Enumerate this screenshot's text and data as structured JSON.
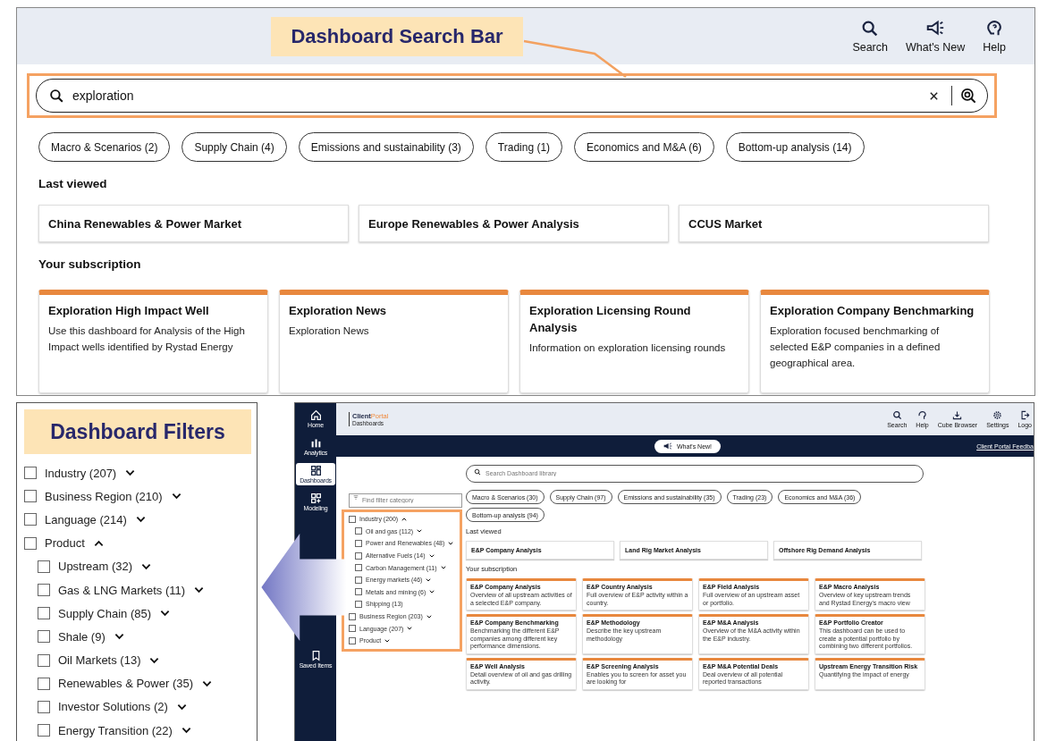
{
  "search_view": {
    "callout": "Dashboard Search Bar",
    "header_actions": [
      {
        "kind": "search",
        "label": "Search"
      },
      {
        "kind": "megaphone",
        "label": "What's New"
      },
      {
        "kind": "help",
        "label": "Help"
      }
    ],
    "search_field": {
      "value": "exploration"
    },
    "categories": [
      "Macro & Scenarios (2)",
      "Supply Chain (4)",
      "Emissions and sustainability (3)",
      "Trading (1)",
      "Economics and M&A (6)",
      "Bottom-up analysis (14)"
    ],
    "last_viewed_heading": "Last viewed",
    "last_viewed": [
      "China Renewables & Power Market",
      "Europe Renewables & Power Analysis",
      "CCUS Market"
    ],
    "subscription_heading": "Your subscription",
    "subscription": [
      {
        "title": "Exploration High Impact Well",
        "description": "Use this dashboard for Analysis of the High Impact wells identified by Rystad Energy"
      },
      {
        "title": "Exploration News",
        "description": "Exploration News"
      },
      {
        "title": "Exploration Licensing Round Analysis",
        "description": "Information on exploration licensing rounds"
      },
      {
        "title": "Exploration Company Benchmarking",
        "description": "Exploration focused benchmarking of selected E&P companies in a defined geographical area."
      }
    ]
  },
  "filters_view": {
    "callout": "Dashboard Filters",
    "filters": [
      {
        "label": "Industry (207)",
        "checked": false,
        "expanded": false
      },
      {
        "label": "Business Region (210)",
        "checked": false,
        "expanded": false
      },
      {
        "label": "Language (214)",
        "checked": false,
        "expanded": false
      },
      {
        "label": "Product",
        "checked": false,
        "expanded": true,
        "children": [
          {
            "label": "Upstream (32)",
            "checked": false,
            "expanded": false
          },
          {
            "label": "Gas & LNG Markets (11)",
            "checked": false,
            "expanded": false
          },
          {
            "label": "Supply Chain (85)",
            "checked": false,
            "expanded": false
          },
          {
            "label": "Shale (9)",
            "checked": false,
            "expanded": false
          },
          {
            "label": "Oil Markets (13)",
            "checked": false,
            "expanded": false
          },
          {
            "label": "Renewables & Power (35)",
            "checked": false,
            "expanded": false
          },
          {
            "label": "Investor Solutions (2)",
            "checked": false,
            "expanded": false
          },
          {
            "label": "Energy Transition (22)",
            "checked": false,
            "expanded": false
          }
        ]
      }
    ]
  },
  "portal": {
    "brand_first": "Client",
    "brand_second": "Portal",
    "section": "Dashboards",
    "nav": [
      {
        "kind": "home",
        "label": "Home",
        "selected": false
      },
      {
        "kind": "analytics",
        "label": "Analytics",
        "selected": false
      },
      {
        "kind": "dashboards",
        "label": "Dashboards",
        "selected": true
      },
      {
        "kind": "modeling",
        "label": "Modeling",
        "selected": false
      },
      {
        "kind": "saved",
        "label": "Saved Items",
        "selected": false
      }
    ],
    "actions": [
      {
        "kind": "search",
        "label": "Search"
      },
      {
        "kind": "help",
        "label": "Help"
      },
      {
        "kind": "download",
        "label": "Cube Browser"
      },
      {
        "kind": "gear",
        "label": "Settings"
      },
      {
        "kind": "logout",
        "label": "Logo"
      }
    ],
    "whats_new": "What's New!",
    "feedback_link": "Client Portal Feedba",
    "search_placeholder": "Search Dashboard library",
    "filter_placeholder": "Find filter category",
    "filters": [
      {
        "label": "Industry (200)",
        "checked": false,
        "expanded": true,
        "children": [
          {
            "label": "Oil and gas (112)",
            "checked": false,
            "expanded": false
          },
          {
            "label": "Power and Renewables (48)",
            "checked": false,
            "expanded": false
          },
          {
            "label": "Alternative Fuels (14)",
            "checked": false,
            "expanded": false
          },
          {
            "label": "Carbon Management (11)",
            "checked": false,
            "expanded": false
          },
          {
            "label": "Energy markets (46)",
            "checked": false,
            "expanded": false
          },
          {
            "label": "Metals and mining (6)",
            "checked": false,
            "expanded": false
          },
          {
            "label": "Shipping (13)",
            "checked": false
          }
        ]
      },
      {
        "label": "Business Region (203)",
        "checked": false,
        "expanded": false
      },
      {
        "label": "Language (207)",
        "checked": false,
        "expanded": false
      },
      {
        "label": "Product",
        "checked": false,
        "expanded": false
      }
    ],
    "categories": [
      "Macro & Scenarios (30)",
      "Supply Chain (97)",
      "Emissions and sustainability (35)",
      "Trading (23)",
      "Economics and M&A (36)",
      "Bottom-up analysis (94)"
    ],
    "last_viewed_heading": "Last viewed",
    "last_viewed": [
      "E&P Company Analysis",
      "Land Rig Market Analysis",
      "Offshore Rig Demand Analysis"
    ],
    "subscription_heading": "Your subscription",
    "subscription": [
      {
        "title": "E&P Company Analysis",
        "description": "Overview of all upstream activities of a selected E&P company."
      },
      {
        "title": "E&P Country Analysis",
        "description": "Full overview of E&P activity within a country."
      },
      {
        "title": "E&P Field Analysis",
        "description": "Full overview of an upstream asset or portfolio."
      },
      {
        "title": "E&P Macro Analysis",
        "description": "Overview of key upstream trends and Rystad Energy's macro view"
      },
      {
        "title": "E&P Company Benchmarking",
        "description": "Benchmarking the different E&P companies among different key performance dimensions."
      },
      {
        "title": "E&P Methodology",
        "description": "Describe the key upstream methodology"
      },
      {
        "title": "E&P M&A Analysis",
        "description": "Overview of the M&A activity within the E&P industry."
      },
      {
        "title": "E&P Portfolio Creator",
        "description": "This dashboard can be used to create a potential portfolio by combining two different portfolios."
      },
      {
        "title": "E&P Well Analysis",
        "description": "Detail overview of oil and gas drilling activity."
      },
      {
        "title": "E&P Screening Analysis",
        "description": "Enables you to screen for asset you are looking for"
      },
      {
        "title": "E&P M&A Potential Deals",
        "description": "Deal overview of all potential reported transactions"
      },
      {
        "title": "Upstream Energy Transition Risk",
        "description": "Quantifying the impact of energy"
      }
    ]
  }
}
